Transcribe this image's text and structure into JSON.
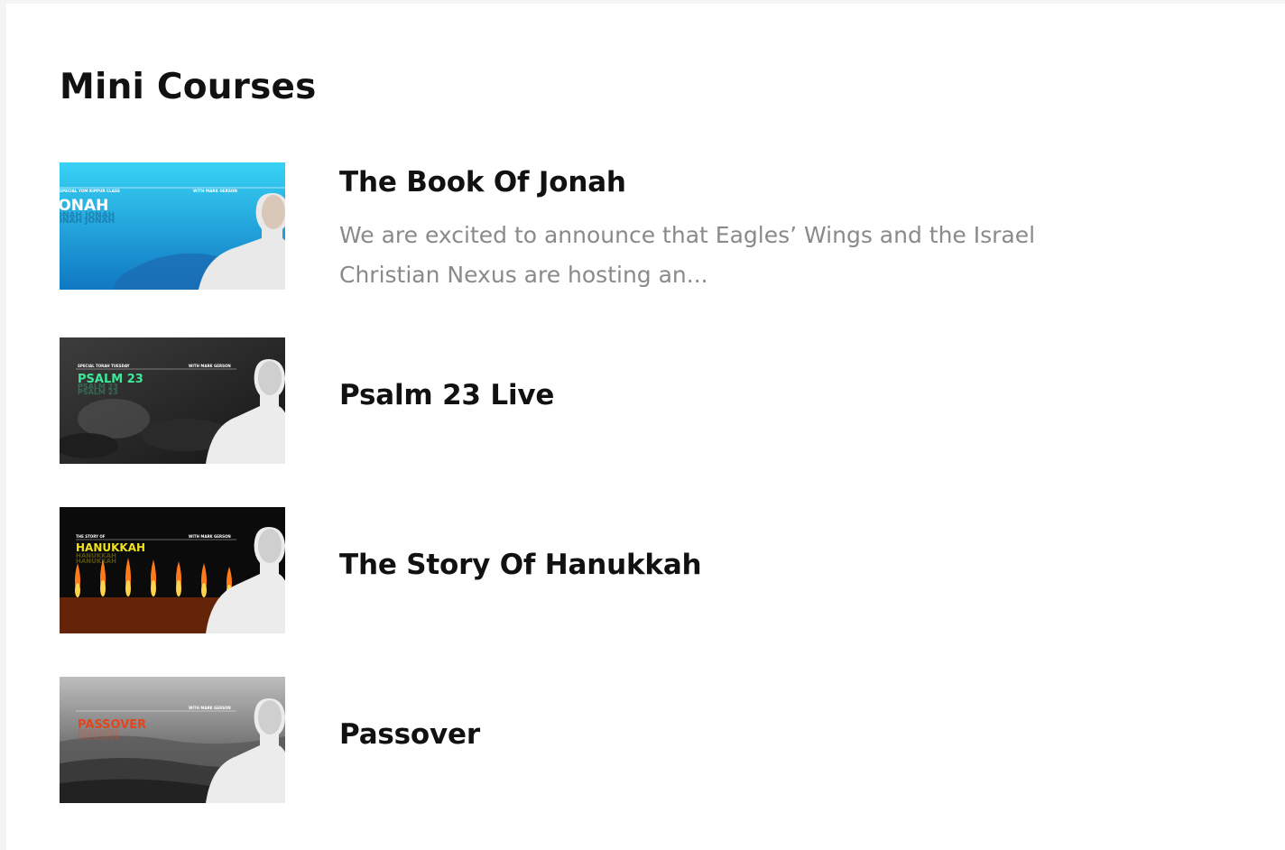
{
  "page": {
    "title": "Mini Courses"
  },
  "courses": [
    {
      "title": "The Book Of Jonah",
      "excerpt": "We are excited to announce that Eagles’ Wings and the Israel Christian Nexus are hosting an...",
      "thumb": {
        "kicker": "SPECIAL YOM KIPPUR CLASS",
        "label": "JONAH",
        "byline": "WITH MARK GERSON",
        "accent": "#ffffff",
        "bg": "#1a9fd8"
      }
    },
    {
      "title": "Psalm 23 Live",
      "thumb": {
        "kicker": "SPECIAL TORAH TUESDAY",
        "label": "PSALM 23",
        "byline": "WITH MARK GERSON",
        "accent": "#3ee89a",
        "bg": "#2a2a2a"
      }
    },
    {
      "title": "The Story Of Hanukkah",
      "thumb": {
        "kicker": "THE STORY OF",
        "label": "HANUKKAH",
        "byline": "WITH MARK GERSON",
        "accent": "#f2e21c",
        "bg": "#0c0c0c"
      }
    },
    {
      "title": "Passover",
      "thumb": {
        "kicker": "",
        "label": "PASSOVER",
        "byline": "WITH MARK GERSON",
        "accent": "#e2461f",
        "bg": "#6e6e6e"
      }
    }
  ]
}
